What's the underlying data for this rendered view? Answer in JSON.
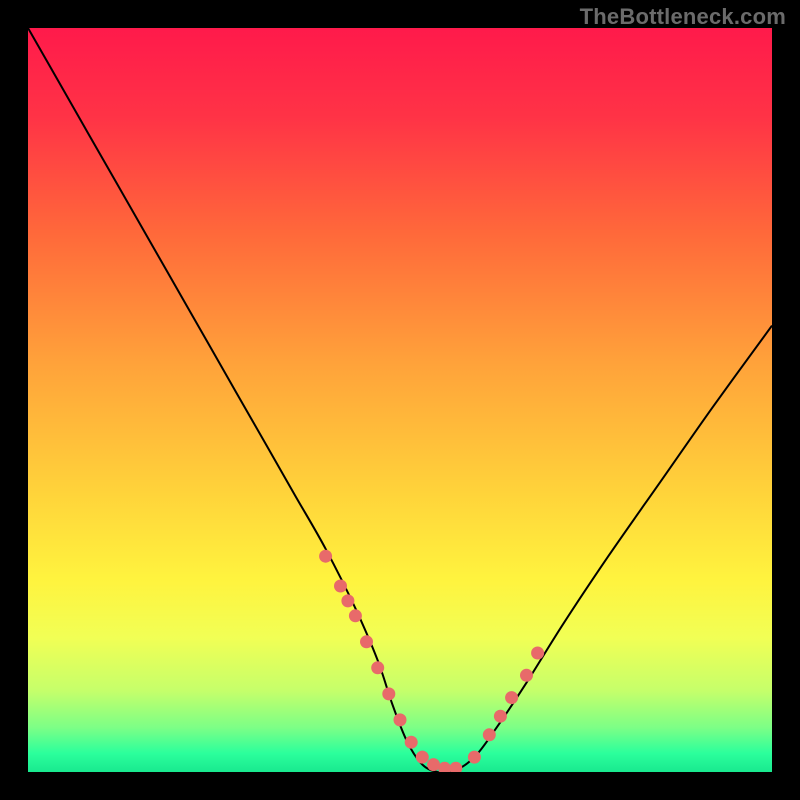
{
  "watermark": "TheBottleneck.com",
  "colors": {
    "curve": "#000000",
    "marker": "#e86a6a",
    "gradient_stops": [
      {
        "offset": 0.0,
        "color": "#ff1a4b"
      },
      {
        "offset": 0.12,
        "color": "#ff3346"
      },
      {
        "offset": 0.28,
        "color": "#ff6a3a"
      },
      {
        "offset": 0.45,
        "color": "#ffa23a"
      },
      {
        "offset": 0.62,
        "color": "#ffd23a"
      },
      {
        "offset": 0.74,
        "color": "#fff33e"
      },
      {
        "offset": 0.82,
        "color": "#f1ff55"
      },
      {
        "offset": 0.89,
        "color": "#c6ff6a"
      },
      {
        "offset": 0.94,
        "color": "#7dff86"
      },
      {
        "offset": 0.975,
        "color": "#2bff9c"
      },
      {
        "offset": 1.0,
        "color": "#19e98f"
      }
    ]
  },
  "chart_data": {
    "type": "line",
    "title": "",
    "xlabel": "",
    "ylabel": "",
    "xlim": [
      0,
      100
    ],
    "ylim": [
      0,
      100
    ],
    "grid": false,
    "legend": false,
    "series": [
      {
        "name": "bottleneck-curve",
        "x": [
          0,
          4,
          8,
          12,
          16,
          20,
          24,
          28,
          32,
          36,
          40,
          44,
          47,
          49,
          51,
          53,
          55,
          57,
          60,
          63,
          67,
          72,
          78,
          85,
          92,
          100
        ],
        "y": [
          100,
          93,
          86,
          79,
          72,
          65,
          58,
          51,
          44,
          37,
          30,
          22,
          15,
          9,
          4,
          1,
          0,
          0,
          2,
          6,
          12,
          20,
          29,
          39,
          49,
          60
        ]
      }
    ],
    "markers": {
      "name": "highlighted-points",
      "color": "#e86a6a",
      "x": [
        40,
        42,
        43,
        44,
        45.5,
        47,
        48.5,
        50,
        51.5,
        53,
        54.5,
        56,
        57.5,
        60,
        62,
        63.5,
        65,
        67,
        68.5
      ],
      "y": [
        29,
        25,
        23,
        21,
        17.5,
        14,
        10.5,
        7,
        4,
        2,
        1,
        0.5,
        0.5,
        2,
        5,
        7.5,
        10,
        13,
        16
      ]
    }
  }
}
